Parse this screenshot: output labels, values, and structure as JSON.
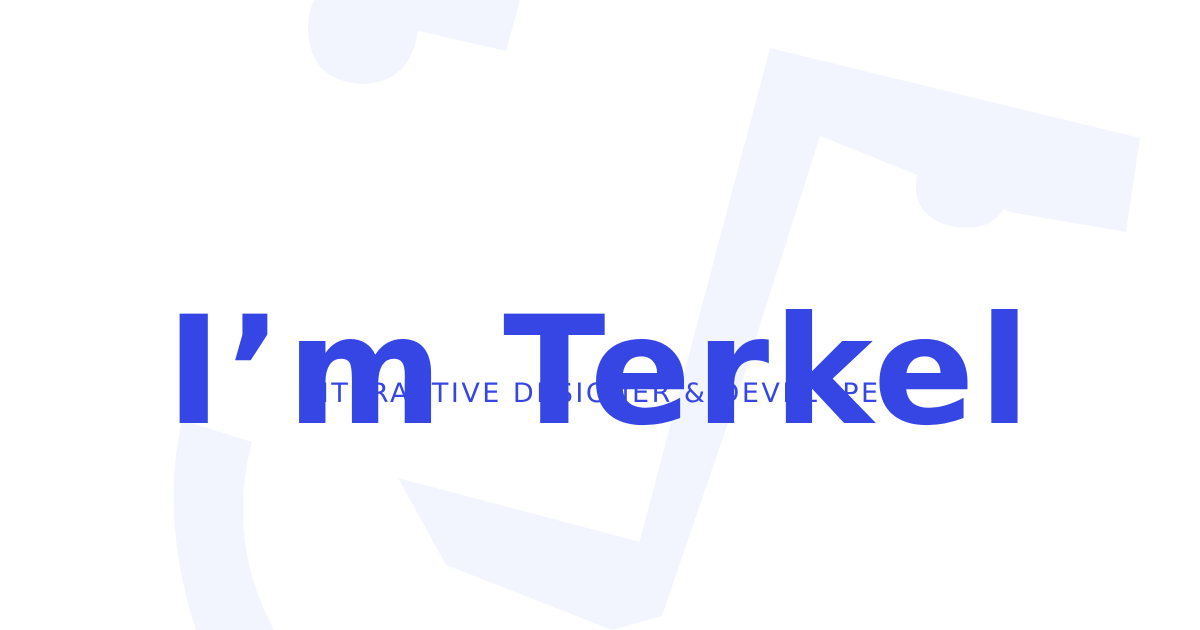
{
  "hero": {
    "title": "I’m Terkel",
    "subtitle": "INTERACTIVE DESIGNER & DEVELOPER"
  },
  "colors": {
    "accent": "#3546e4",
    "background": "#ffffff",
    "shape": "#f2f5fd"
  },
  "background": {
    "decoration": "large-abstract-logo-shapes"
  }
}
